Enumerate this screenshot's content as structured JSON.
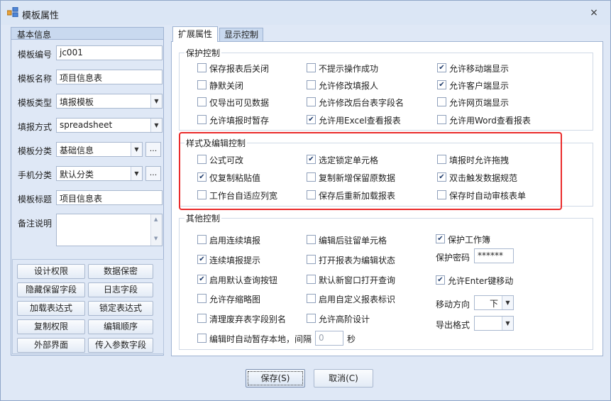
{
  "window": {
    "title": "模板属性",
    "close_glyph": "×"
  },
  "left": {
    "group_title": "基本信息",
    "fields": {
      "code_label": "模板编号",
      "code_value": "jc001",
      "name_label": "模板名称",
      "name_value": "项目信息表",
      "type_label": "模板类型",
      "type_value": "填报模板",
      "fill_label": "填报方式",
      "fill_value": "spreadsheet",
      "cat_label": "模板分类",
      "cat_value": "基础信息",
      "mobile_label": "手机分类",
      "mobile_value": "默认分类",
      "caption_label": "模板标题",
      "caption_value": "项目信息表",
      "remark_label": "备注说明",
      "remark_value": ""
    },
    "ellipsis": "...",
    "buttons": [
      "设计权限",
      "数据保密",
      "隐藏保留字段",
      "日志字段",
      "加载表达式",
      "锁定表达式",
      "复制权限",
      "编辑顺序",
      "外部界面",
      "传入参数字段"
    ]
  },
  "tabs": {
    "active": "扩展属性",
    "other": "显示控制"
  },
  "protect": {
    "title": "保护控制",
    "items": [
      {
        "label": "保存报表后关闭",
        "checked": false
      },
      {
        "label": "不提示操作成功",
        "checked": false
      },
      {
        "label": "允许移动端显示",
        "checked": true
      },
      {
        "label": "静默关闭",
        "checked": false
      },
      {
        "label": "允许修改填报人",
        "checked": false
      },
      {
        "label": "允许客户端显示",
        "checked": true
      },
      {
        "label": "仅导出可见数据",
        "checked": false
      },
      {
        "label": "允许修改后台表字段名",
        "checked": false
      },
      {
        "label": "允许网页端显示",
        "checked": false
      },
      {
        "label": "允许填报时暂存",
        "checked": false
      },
      {
        "label": "允许用Excel查看报表",
        "checked": true
      },
      {
        "label": "允许用Word查看报表",
        "checked": false
      }
    ]
  },
  "style": {
    "title": "样式及编辑控制",
    "items": [
      {
        "label": "公式可改",
        "checked": false
      },
      {
        "label": "选定锁定单元格",
        "checked": true
      },
      {
        "label": "填报时允许拖拽",
        "checked": false
      },
      {
        "label": "仅复制粘贴值",
        "checked": true
      },
      {
        "label": "复制新增保留原数据",
        "checked": false
      },
      {
        "label": "双击触发数据规范",
        "checked": true
      },
      {
        "label": "工作台自适应列宽",
        "checked": false
      },
      {
        "label": "保存后重新加载报表",
        "checked": false
      },
      {
        "label": "保存时自动审核表单",
        "checked": false
      }
    ]
  },
  "other": {
    "title": "其他控制",
    "items": [
      {
        "label": "启用连续填报",
        "checked": false
      },
      {
        "label": "编辑后驻留单元格",
        "checked": false
      },
      {
        "label": "连续填报提示",
        "checked": true
      },
      {
        "label": "打开报表为编辑状态",
        "checked": false
      },
      {
        "label": "启用默认查询按钮",
        "checked": true
      },
      {
        "label": "默认新窗口打开查询",
        "checked": false
      },
      {
        "label": "允许存缩略图",
        "checked": false
      },
      {
        "label": "启用自定义报表标识",
        "checked": false
      },
      {
        "label": "清理废弃表字段别名",
        "checked": false
      },
      {
        "label": "允许高阶设计",
        "checked": false
      }
    ],
    "protect_book": {
      "label": "保护工作簿",
      "checked": true
    },
    "pwd_label": "保护密码",
    "pwd_value": "******",
    "enter_move": {
      "label": "允许Enter键移动",
      "checked": true
    },
    "dir_label": "移动方向",
    "dir_value": "下",
    "export_label": "导出格式",
    "export_value": "",
    "autosave": {
      "label": "编辑时自动暂存本地，间隔",
      "checked": false,
      "value": "0",
      "unit": "秒"
    }
  },
  "footer": {
    "save": "保存(S)",
    "cancel": "取消(C)"
  }
}
